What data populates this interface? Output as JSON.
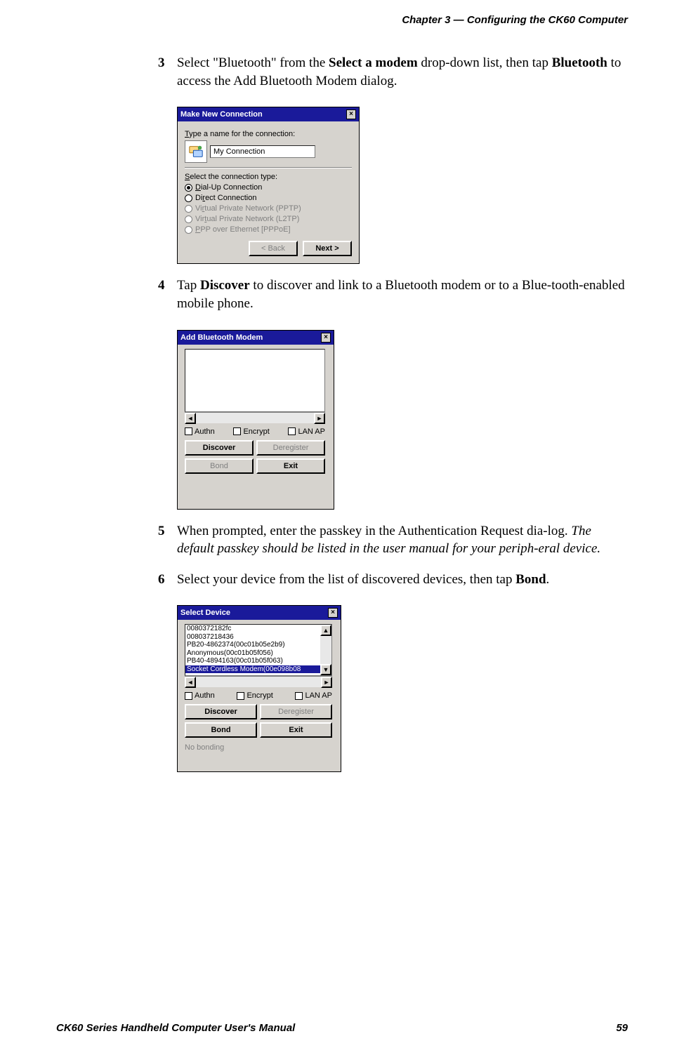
{
  "header": {
    "chapter": "Chapter 3 —  Configuring the CK60 Computer"
  },
  "steps": {
    "s3": {
      "num": "3",
      "t1": "Select \"Bluetooth\" from the ",
      "b1": "Select a modem",
      "t2": " drop-down list, then tap ",
      "b2": "Bluetooth",
      "t3": " to access the Add Bluetooth Modem dialog."
    },
    "s4": {
      "num": "4",
      "t1": "Tap ",
      "b1": "Discover",
      "t2": " to discover and link to a Bluetooth modem or to a Blue-tooth-enabled mobile phone."
    },
    "s5": {
      "num": "5",
      "t1": "When prompted, enter the passkey in the Authentication Request dia-log. ",
      "i1": "The default passkey should be listed in the user manual for your periph-eral device."
    },
    "s6": {
      "num": "6",
      "t1": "Select your device from the list of discovered devices, then tap ",
      "b1": "Bond",
      "t2": "."
    }
  },
  "dlg1": {
    "title": "Make New Connection",
    "close": "×",
    "name_label_pre": "T",
    "name_label": "ype a name for the connection:",
    "name_value": "My Connection",
    "type_label_pre": "S",
    "type_label": "elect the connection type:",
    "opt_dial_pre": "D",
    "opt_dial": "ial-Up Connection",
    "opt_direct_pre": "Di",
    "opt_direct_u": "r",
    "opt_direct_post": "ect Connection",
    "opt_pptp_pre": "Vi",
    "opt_pptp_u": "r",
    "opt_pptp_post": "tual Private Network (PPTP)",
    "opt_l2tp_pre": "Vir",
    "opt_l2tp_u": "t",
    "opt_l2tp_post": "ual Private Network (L2TP)",
    "opt_pppoe_pre": "P",
    "opt_pppoe": "PP over Ethernet [PPPoE]",
    "back": "< Back",
    "next": "Next >"
  },
  "dlg2": {
    "title": "Add Bluetooth Modem",
    "close": "×",
    "arrow_left": "◄",
    "arrow_right": "►",
    "authn": "Authn",
    "encrypt": "Encrypt",
    "lanap": "LAN AP",
    "discover": "Discover",
    "deregister": "Deregister",
    "bond": "Bond",
    "exit": "Exit"
  },
  "dlg3": {
    "title": "Select Device",
    "close": "×",
    "devices": {
      "d0": "0080372182fc",
      "d1": "008037218436",
      "d2": "PB20-4862374(00c01b05e2b9)",
      "d3": "Anonymous(00c01b05f056)",
      "d4": "PB40-4894163(00c01b05f063)",
      "d5": "Socket Cordless Modem(00e098b08"
    },
    "arrow_up": "▲",
    "arrow_down": "▼",
    "arrow_left": "◄",
    "arrow_right": "►",
    "authn": "Authn",
    "encrypt": "Encrypt",
    "lanap": "LAN AP",
    "discover": "Discover",
    "deregister": "Deregister",
    "bond": "Bond",
    "exit": "Exit",
    "status": "No bonding"
  },
  "footer": {
    "manual": "CK60 Series Handheld Computer User's Manual",
    "page": "59"
  }
}
